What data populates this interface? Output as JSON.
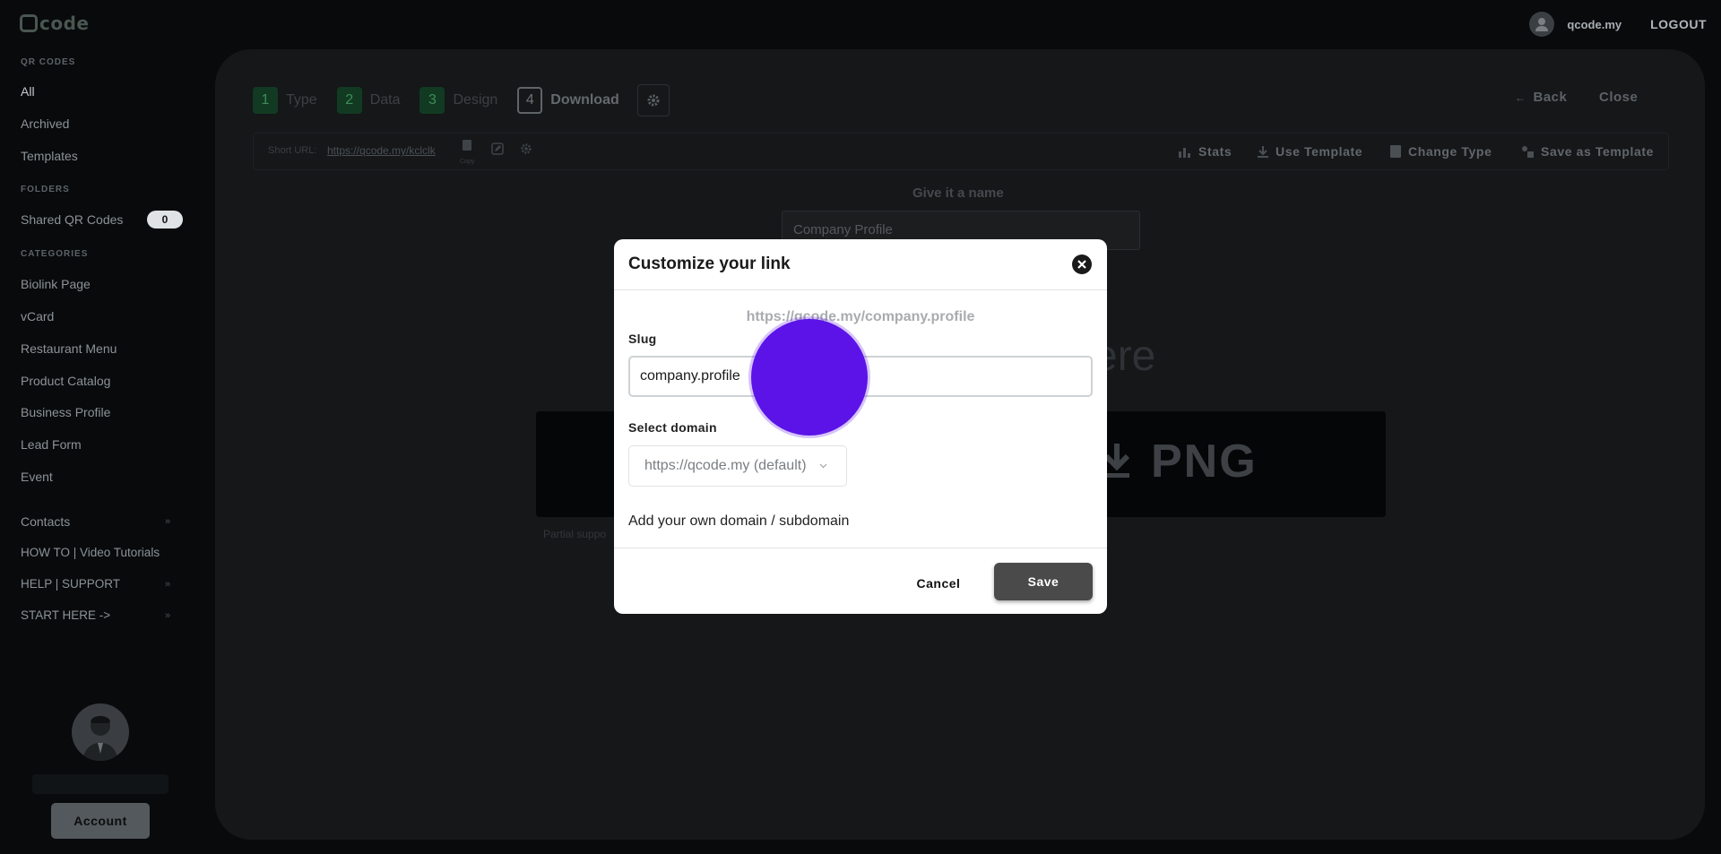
{
  "app": {
    "logo_text": "code",
    "user_name": "qcode.my",
    "logout_label": "LOGOUT"
  },
  "sidebar": {
    "qr_codes_title": "QR CODES",
    "qr_items": [
      {
        "label": "All"
      },
      {
        "label": "Archived"
      },
      {
        "label": "Templates"
      }
    ],
    "folders_title": "FOLDERS",
    "shared_label": "Shared QR Codes",
    "shared_count": "0",
    "categories_title": "CATEGORIES",
    "categories": [
      {
        "label": "Biolink Page"
      },
      {
        "label": "vCard"
      },
      {
        "label": "Restaurant Menu"
      },
      {
        "label": "Product Catalog"
      },
      {
        "label": "Business Profile"
      },
      {
        "label": "Lead Form"
      },
      {
        "label": "Event"
      }
    ],
    "links": [
      {
        "label": "Contacts"
      },
      {
        "label": "HOW TO | Video Tutorials"
      },
      {
        "label": "HELP | SUPPORT"
      },
      {
        "label": "START HERE ->"
      }
    ],
    "account_label": "Account"
  },
  "steps": [
    {
      "num": "1",
      "label": "Type"
    },
    {
      "num": "2",
      "label": "Data"
    },
    {
      "num": "3",
      "label": "Design"
    },
    {
      "num": "4",
      "label": "Download"
    }
  ],
  "nav": {
    "back_label": "Back",
    "close_label": "Close"
  },
  "toolbar": {
    "short_url_label": "Short URL:",
    "short_url": "https://qcode.my/kclclk",
    "copy_label": "Copy",
    "stats_label": "Stats",
    "use_template_label": "Use Template",
    "change_type_label": "Change Type",
    "save_template_label": "Save as Template"
  },
  "background": {
    "name_label": "Give it a name",
    "name_value": "Company Profile",
    "here_text": "ere",
    "download_format": "PNG",
    "partial_text": "Partial suppo"
  },
  "modal": {
    "title": "Customize your link",
    "preview_url": "https://qcode.my/company.profile",
    "slug_label": "Slug",
    "slug_value": "company.profile",
    "domain_label": "Select domain",
    "domain_value": "https://qcode.my (default)",
    "add_domain_label": "Add your own domain / subdomain",
    "cancel_label": "Cancel",
    "save_label": "Save"
  },
  "colors": {
    "accent_click": "#5b13e8",
    "step_done": "#123a22",
    "save_button": "#4a4a4a"
  }
}
